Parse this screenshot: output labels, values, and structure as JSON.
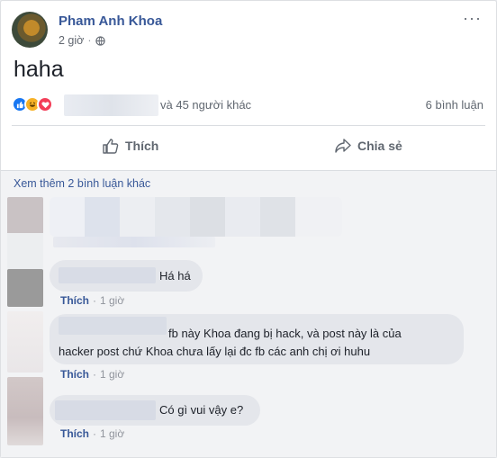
{
  "post": {
    "author": "Pham Anh Khoa",
    "time": "2 giờ",
    "dot": "·",
    "text": "haha",
    "more_glyph": "···",
    "reactions": {
      "icons": [
        "like-icon",
        "haha-icon",
        "love-icon"
      ],
      "others": "và 45 người khác",
      "comment_count": "6 bình luận"
    },
    "actions": {
      "like": "Thích",
      "share": "Chia sẻ"
    }
  },
  "comments_section": {
    "view_more": "Xem thêm 2 bình luận khác",
    "comments": [
      {
        "text": "Há há",
        "like_label": "Thích",
        "dot": "·",
        "time": "1 giờ"
      },
      {
        "text": "fb này Khoa đang bị hack, và post này là của",
        "text_line2": "hacker post chứ Khoa chưa lấy lại đc fb các anh chị ơi huhu",
        "like_label": "Thích",
        "dot": "·",
        "time": "1 giờ"
      },
      {
        "text": "Có gì vui vậy e?",
        "like_label": "Thích",
        "dot": "·",
        "time": "1 giờ"
      }
    ]
  },
  "colors": {
    "link": "#385898",
    "secondary_text": "#606770",
    "bubble": "#e4e6eb",
    "like_reaction": "#1877f2",
    "haha_reaction": "#f7b125",
    "love_reaction": "#f33e58"
  }
}
